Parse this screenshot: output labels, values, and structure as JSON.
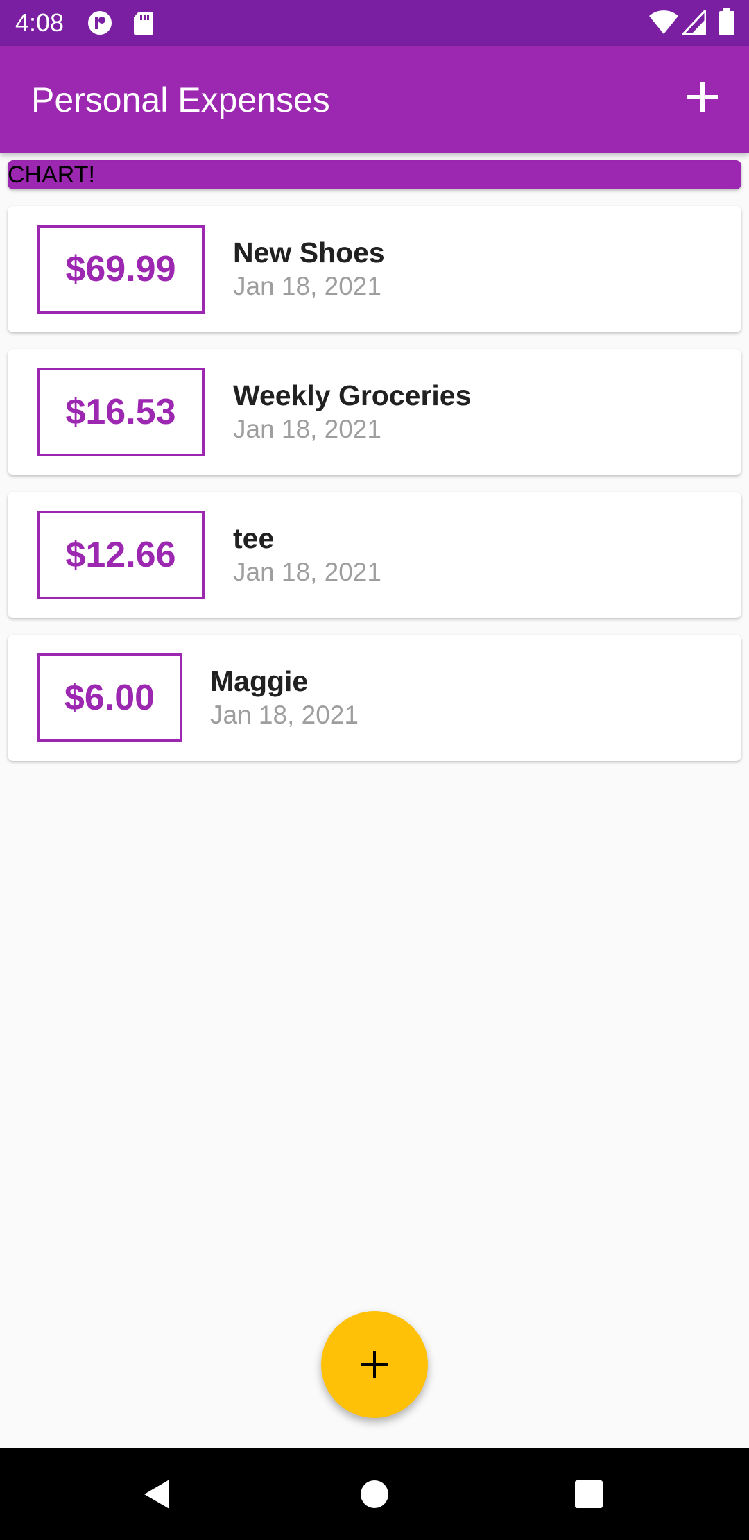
{
  "status_bar": {
    "time": "4:08",
    "icons": [
      "app-notification-icon",
      "sd-card-icon",
      "wifi-icon",
      "cellular-signal-icon",
      "battery-icon"
    ]
  },
  "app_bar": {
    "title": "Personal Expenses",
    "add_icon": "plus-icon"
  },
  "chart": {
    "label": "CHART!"
  },
  "transactions": [
    {
      "amount": "$69.99",
      "title": "New Shoes",
      "date": "Jan 18, 2021"
    },
    {
      "amount": "$16.53",
      "title": "Weekly Groceries",
      "date": "Jan 18, 2021"
    },
    {
      "amount": "$12.66",
      "title": "tee",
      "date": "Jan 18, 2021"
    },
    {
      "amount": "$6.00",
      "title": "Maggie",
      "date": "Jan 18, 2021"
    }
  ],
  "fab": {
    "icon": "plus-icon"
  },
  "nav_bar": {
    "icons": [
      "back-icon",
      "home-icon",
      "recents-icon"
    ]
  },
  "colors": {
    "primary": "#9c27b0",
    "primary_dark": "#7b1fa2",
    "accent": "#ffc107",
    "background": "#fafafa",
    "title_text": "#212121",
    "date_text": "#9e9e9e"
  }
}
